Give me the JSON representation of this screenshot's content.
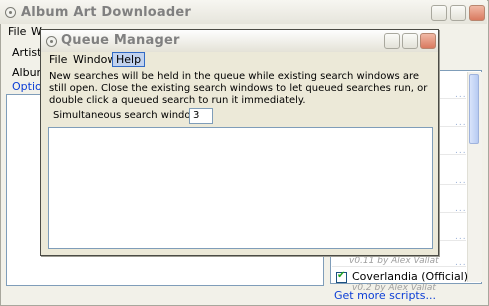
{
  "main": {
    "title": "Album Art Downloader",
    "menu": [
      "File",
      "W"
    ],
    "artist_label": "Artist:",
    "album_label": "Album:",
    "options_link": "Option"
  },
  "scripts_panel": {
    "entries": [
      {
        "dots": "..."
      },
      {
        "dots": "..."
      },
      {
        "dots": "..."
      },
      {
        "dots": "..."
      },
      {
        "dots": "..."
      },
      {
        "dots": "..."
      },
      {
        "dots": "..."
      }
    ],
    "faint_text_1": "v0.11 by Alex Vallat",
    "item_label": "Coverlandia (Official)",
    "faint_text_2": "v0.2 by Alex Vallat",
    "more_link": "Get more scripts..."
  },
  "queue_manager": {
    "title": "Queue Manager",
    "menu": {
      "file": "File",
      "window": "Window",
      "help": "Help"
    },
    "description": "New searches will be held in the queue while existing search windows are still open. Close the existing search windows to let queued searches run, or double click a queued search to run it immediately.",
    "sim_label": "Simultaneous search windows:",
    "sim_value": "3"
  },
  "colors": {
    "link": "#0b3dd6",
    "accent_close": "#d97a60"
  }
}
